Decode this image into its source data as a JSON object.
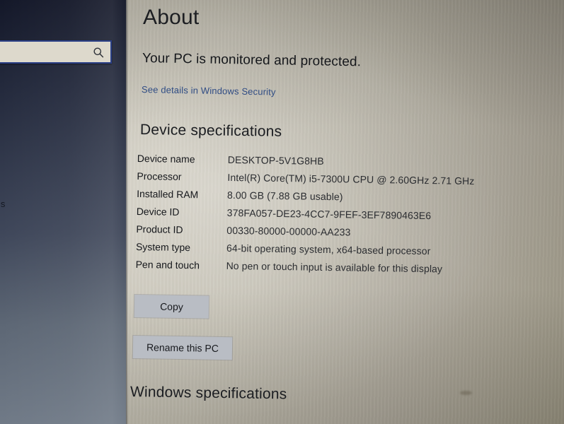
{
  "sidebar": {
    "search": {
      "value": "",
      "placeholder": "",
      "icon": "search-icon"
    },
    "nav_fragment_label": "ons"
  },
  "page": {
    "title": "About",
    "protection_status": "Your PC is monitored and protected.",
    "security_link": "See details in Windows Security"
  },
  "device_specifications": {
    "heading": "Device specifications",
    "rows": [
      {
        "label": "Device name",
        "value": "DESKTOP-5V1G8HB"
      },
      {
        "label": "Processor",
        "value": "Intel(R) Core(TM) i5-7300U CPU @ 2.60GHz   2.71 GHz"
      },
      {
        "label": "Installed RAM",
        "value": "8.00 GB (7.88 GB usable)"
      },
      {
        "label": "Device ID",
        "value": "378FA057-DE23-4CC7-9FEF-3EF7890463E6"
      },
      {
        "label": "Product ID",
        "value": "00330-80000-00000-AA233"
      },
      {
        "label": "System type",
        "value": "64-bit operating system, x64-based processor"
      },
      {
        "label": "Pen and touch",
        "value": "No pen or touch input is available for this display"
      }
    ],
    "copy_button": "Copy",
    "rename_button": "Rename this PC"
  },
  "windows_specifications": {
    "heading": "Windows specifications"
  },
  "colors": {
    "sidebar_top": "#141829",
    "sidebar_bottom": "#707a87",
    "panel_light": "#cdc9bc",
    "panel_dark": "#96917f",
    "link_blue": "#2f4c84",
    "button_fill": "#b9bdc4",
    "search_border": "#2a3f86",
    "text_primary": "#16181c"
  }
}
